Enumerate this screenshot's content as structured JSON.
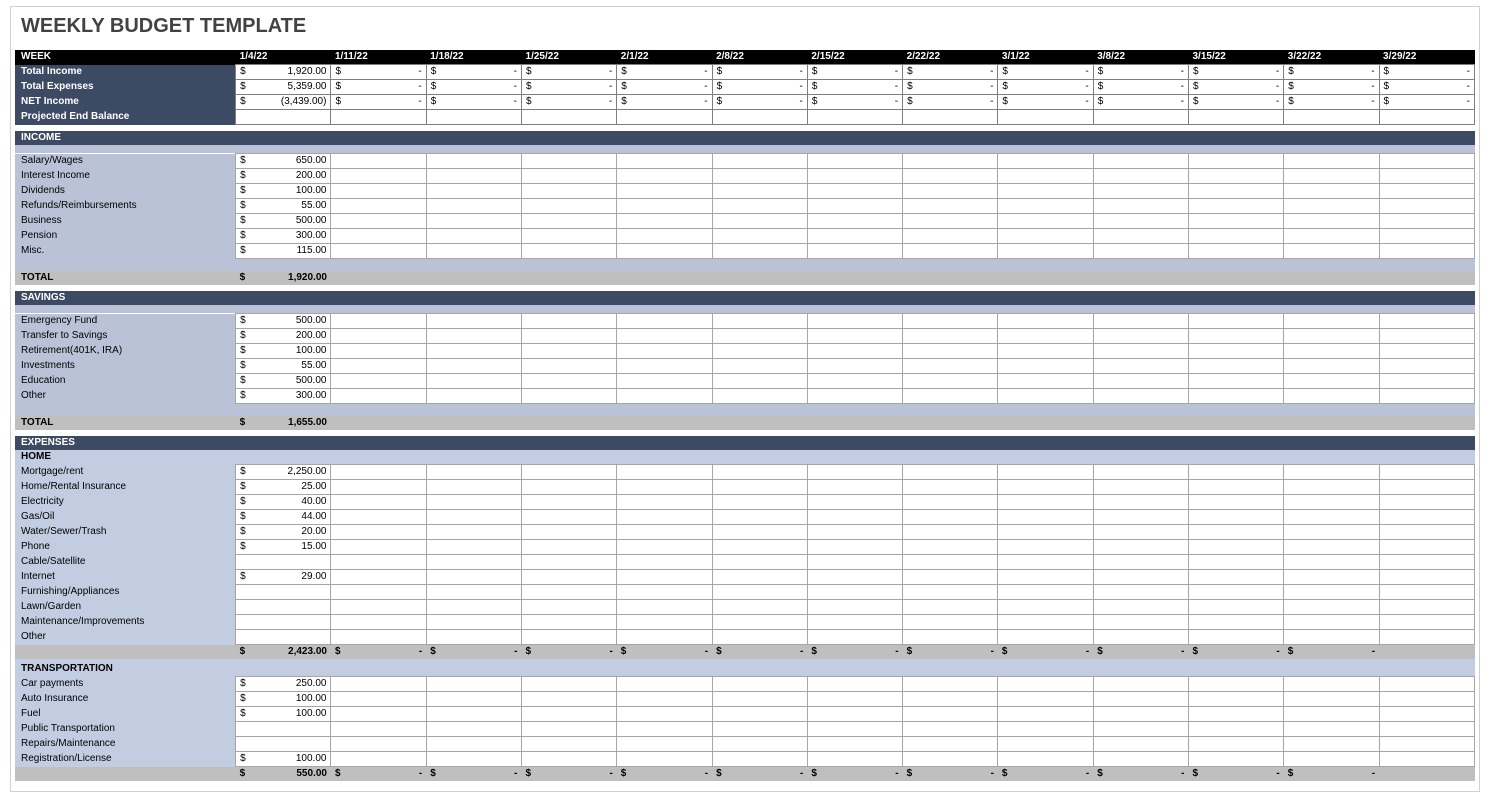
{
  "title": "WEEKLY BUDGET TEMPLATE",
  "weeks": [
    "1/4/22",
    "1/11/22",
    "1/18/22",
    "1/25/22",
    "2/1/22",
    "2/8/22",
    "2/15/22",
    "2/22/22",
    "3/1/22",
    "3/8/22",
    "3/15/22",
    "3/22/22",
    "3/29/22"
  ],
  "summary": [
    {
      "label": "Total Income",
      "values": [
        "1,920.00",
        "-",
        "-",
        "-",
        "-",
        "-",
        "-",
        "-",
        "-",
        "-",
        "-",
        "-",
        "-"
      ]
    },
    {
      "label": "Total Expenses",
      "values": [
        "5,359.00",
        "-",
        "-",
        "-",
        "-",
        "-",
        "-",
        "-",
        "-",
        "-",
        "-",
        "-",
        "-"
      ]
    },
    {
      "label": "NET Income",
      "values": [
        "(3,439.00)",
        "-",
        "-",
        "-",
        "-",
        "-",
        "-",
        "-",
        "-",
        "-",
        "-",
        "-",
        "-"
      ]
    },
    {
      "label": "Projected End Balance",
      "values": [
        "",
        "",
        "",
        "",
        "",
        "",
        "",
        "",
        "",
        "",
        "",
        "",
        ""
      ]
    }
  ],
  "sections": [
    {
      "key": "income",
      "title": "INCOME",
      "blue": true,
      "rows": [
        {
          "label": "Salary/Wages",
          "values": [
            "650.00",
            "",
            "",
            "",
            "",
            "",
            "",
            "",
            "",
            "",
            "",
            "",
            ""
          ]
        },
        {
          "label": "Interest Income",
          "values": [
            "200.00",
            "",
            "",
            "",
            "",
            "",
            "",
            "",
            "",
            "",
            "",
            "",
            ""
          ]
        },
        {
          "label": "Dividends",
          "values": [
            "100.00",
            "",
            "",
            "",
            "",
            "",
            "",
            "",
            "",
            "",
            "",
            "",
            ""
          ]
        },
        {
          "label": "Refunds/Reimbursements",
          "values": [
            "55.00",
            "",
            "",
            "",
            "",
            "",
            "",
            "",
            "",
            "",
            "",
            "",
            ""
          ]
        },
        {
          "label": "Business",
          "values": [
            "500.00",
            "",
            "",
            "",
            "",
            "",
            "",
            "",
            "",
            "",
            "",
            "",
            ""
          ]
        },
        {
          "label": "Pension",
          "values": [
            "300.00",
            "",
            "",
            "",
            "",
            "",
            "",
            "",
            "",
            "",
            "",
            "",
            ""
          ]
        },
        {
          "label": "Misc.",
          "values": [
            "115.00",
            "",
            "",
            "",
            "",
            "",
            "",
            "",
            "",
            "",
            "",
            "",
            ""
          ]
        }
      ],
      "blankRow": true,
      "total": {
        "label": "TOTAL",
        "values": [
          "1,920.00",
          "",
          "",
          "",
          "",
          "",
          "",
          "",
          "",
          "",
          "",
          "",
          ""
        ]
      }
    },
    {
      "key": "savings",
      "title": "SAVINGS",
      "blue": true,
      "rows": [
        {
          "label": "Emergency Fund",
          "values": [
            "500.00",
            "",
            "",
            "",
            "",
            "",
            "",
            "",
            "",
            "",
            "",
            "",
            ""
          ]
        },
        {
          "label": "Transfer to Savings",
          "values": [
            "200.00",
            "",
            "",
            "",
            "",
            "",
            "",
            "",
            "",
            "",
            "",
            "",
            ""
          ]
        },
        {
          "label": "Retirement(401K, IRA)",
          "values": [
            "100.00",
            "",
            "",
            "",
            "",
            "",
            "",
            "",
            "",
            "",
            "",
            "",
            ""
          ]
        },
        {
          "label": "Investments",
          "values": [
            "55.00",
            "",
            "",
            "",
            "",
            "",
            "",
            "",
            "",
            "",
            "",
            "",
            ""
          ]
        },
        {
          "label": "Education",
          "values": [
            "500.00",
            "",
            "",
            "",
            "",
            "",
            "",
            "",
            "",
            "",
            "",
            "",
            ""
          ]
        },
        {
          "label": "Other",
          "values": [
            "300.00",
            "",
            "",
            "",
            "",
            "",
            "",
            "",
            "",
            "",
            "",
            "",
            ""
          ]
        }
      ],
      "blankRow": true,
      "total": {
        "label": "TOTAL",
        "values": [
          "1,655.00",
          "",
          "",
          "",
          "",
          "",
          "",
          "",
          "",
          "",
          "",
          "",
          ""
        ]
      }
    },
    {
      "key": "expenses",
      "title": "EXPENSES",
      "blue": true,
      "groups": [
        {
          "title": "HOME",
          "rows": [
            {
              "label": "Mortgage/rent",
              "values": [
                "2,250.00",
                "",
                "",
                "",
                "",
                "",
                "",
                "",
                "",
                "",
                "",
                "",
                ""
              ]
            },
            {
              "label": "Home/Rental Insurance",
              "values": [
                "25.00",
                "",
                "",
                "",
                "",
                "",
                "",
                "",
                "",
                "",
                "",
                "",
                ""
              ]
            },
            {
              "label": "Electricity",
              "values": [
                "40.00",
                "",
                "",
                "",
                "",
                "",
                "",
                "",
                "",
                "",
                "",
                "",
                ""
              ]
            },
            {
              "label": "Gas/Oil",
              "values": [
                "44.00",
                "",
                "",
                "",
                "",
                "",
                "",
                "",
                "",
                "",
                "",
                "",
                ""
              ]
            },
            {
              "label": "Water/Sewer/Trash",
              "values": [
                "20.00",
                "",
                "",
                "",
                "",
                "",
                "",
                "",
                "",
                "",
                "",
                "",
                ""
              ]
            },
            {
              "label": "Phone",
              "values": [
                "15.00",
                "",
                "",
                "",
                "",
                "",
                "",
                "",
                "",
                "",
                "",
                "",
                ""
              ]
            },
            {
              "label": "Cable/Satellite",
              "values": [
                "",
                "",
                "",
                "",
                "",
                "",
                "",
                "",
                "",
                "",
                "",
                "",
                ""
              ]
            },
            {
              "label": "Internet",
              "values": [
                "29.00",
                "",
                "",
                "",
                "",
                "",
                "",
                "",
                "",
                "",
                "",
                "",
                ""
              ]
            },
            {
              "label": "Furnishing/Appliances",
              "values": [
                "",
                "",
                "",
                "",
                "",
                "",
                "",
                "",
                "",
                "",
                "",
                "",
                ""
              ]
            },
            {
              "label": "Lawn/Garden",
              "values": [
                "",
                "",
                "",
                "",
                "",
                "",
                "",
                "",
                "",
                "",
                "",
                "",
                ""
              ]
            },
            {
              "label": "Maintenance/Improvements",
              "values": [
                "",
                "",
                "",
                "",
                "",
                "",
                "",
                "",
                "",
                "",
                "",
                "",
                ""
              ]
            },
            {
              "label": "Other",
              "values": [
                "",
                "",
                "",
                "",
                "",
                "",
                "",
                "",
                "",
                "",
                "",
                "",
                ""
              ]
            }
          ],
          "subtotal": [
            "2,423.00",
            "-",
            "-",
            "-",
            "-",
            "-",
            "-",
            "-",
            "-",
            "-",
            "-",
            "-",
            ""
          ]
        },
        {
          "title": "TRANSPORTATION",
          "rows": [
            {
              "label": "Car payments",
              "values": [
                "250.00",
                "",
                "",
                "",
                "",
                "",
                "",
                "",
                "",
                "",
                "",
                "",
                ""
              ]
            },
            {
              "label": "Auto Insurance",
              "values": [
                "100.00",
                "",
                "",
                "",
                "",
                "",
                "",
                "",
                "",
                "",
                "",
                "",
                ""
              ]
            },
            {
              "label": "Fuel",
              "values": [
                "100.00",
                "",
                "",
                "",
                "",
                "",
                "",
                "",
                "",
                "",
                "",
                "",
                ""
              ]
            },
            {
              "label": "Public Transportation",
              "values": [
                "",
                "",
                "",
                "",
                "",
                "",
                "",
                "",
                "",
                "",
                "",
                "",
                ""
              ]
            },
            {
              "label": "Repairs/Maintenance",
              "values": [
                "",
                "",
                "",
                "",
                "",
                "",
                "",
                "",
                "",
                "",
                "",
                "",
                ""
              ]
            },
            {
              "label": "Registration/License",
              "values": [
                "100.00",
                "",
                "",
                "",
                "",
                "",
                "",
                "",
                "",
                "",
                "",
                "",
                ""
              ]
            }
          ],
          "subtotal": [
            "550.00",
            "-",
            "-",
            "-",
            "-",
            "-",
            "-",
            "-",
            "-",
            "-",
            "-",
            "-",
            ""
          ]
        }
      ]
    }
  ]
}
